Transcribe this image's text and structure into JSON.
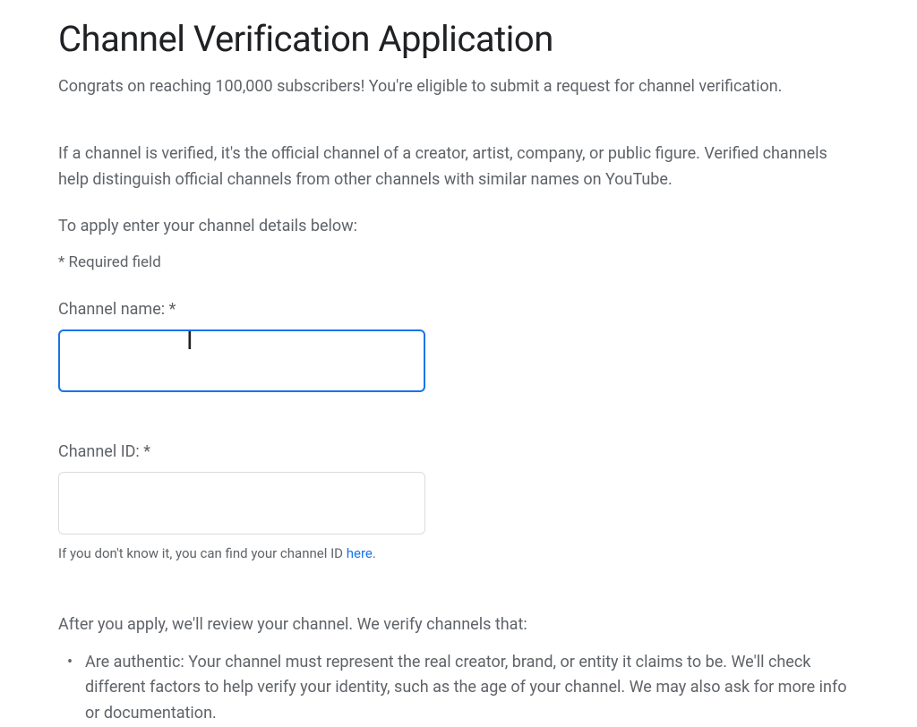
{
  "title": "Channel Verification Application",
  "subtitle": "Congrats on reaching 100,000 subscribers! You're eligible to submit a request for channel verification.",
  "description": "If a channel is verified, it's the official channel of a creator, artist, company, or public figure. Verified channels help distinguish official channels from other channels with similar names on YouTube.",
  "instruction": "To apply enter your channel details below:",
  "required_note": "* Required field",
  "fields": {
    "channel_name": {
      "label": "Channel name: *",
      "value": ""
    },
    "channel_id": {
      "label": "Channel ID: *",
      "value": "",
      "helper_prefix": "If you don't know it, you can find your channel ID ",
      "helper_link": "here",
      "helper_suffix": "."
    }
  },
  "review": {
    "heading": "After you apply, we'll review your channel. We verify channels that:",
    "bullets": [
      "Are authentic: Your channel must represent the real creator, brand, or entity it claims to be. We'll check different factors to help verify your identity, such as the age of your channel. We may also ask for more info or documentation."
    ]
  }
}
